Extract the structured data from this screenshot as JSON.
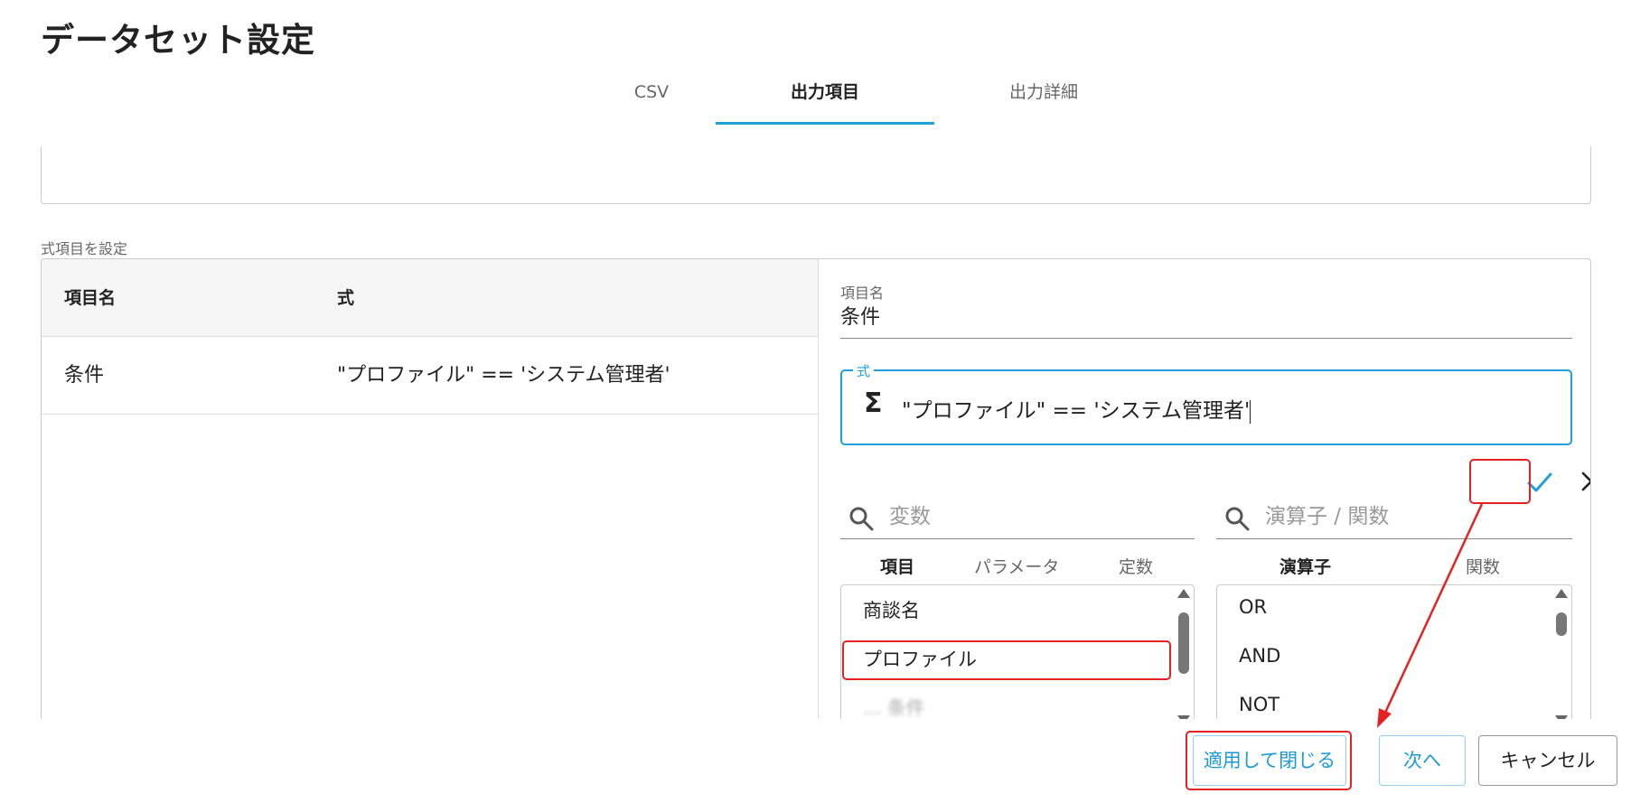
{
  "page": {
    "title": "データセット設定"
  },
  "tabs": [
    {
      "label": "CSV",
      "active": false
    },
    {
      "label": "出力項目",
      "active": true
    },
    {
      "label": "出力詳細",
      "active": false
    }
  ],
  "section": {
    "label": "式項目を設定"
  },
  "table": {
    "headers": [
      "項目名",
      "式"
    ],
    "rows": [
      {
        "name": "条件",
        "formula": "\"プロファイル\" == 'システム管理者'"
      }
    ]
  },
  "editor": {
    "name_label": "項目名",
    "name_value": "条件",
    "formula_label": "式",
    "formula_value": "\"プロファイル\" == 'システム管理者'",
    "sigma_symbol": "Σ",
    "confirm_icon": "check-icon",
    "cancel_icon": "close-icon"
  },
  "variables": {
    "search_placeholder": "変数",
    "tabs": [
      "項目",
      "パラメータ",
      "定数"
    ],
    "active_tab": "項目",
    "items": [
      "商談名",
      "プロファイル",
      "... 条件"
    ]
  },
  "operators": {
    "search_placeholder": "演算子 / 関数",
    "tabs": [
      "演算子",
      "関数"
    ],
    "active_tab": "演算子",
    "items": [
      "OR",
      "AND",
      "NOT"
    ]
  },
  "footer": {
    "apply_label": "適用して閉じる",
    "next_label": "次へ",
    "cancel_label": "キャンセル"
  },
  "colors": {
    "accent": "#1fa0d8",
    "annotation": "#e52222"
  }
}
